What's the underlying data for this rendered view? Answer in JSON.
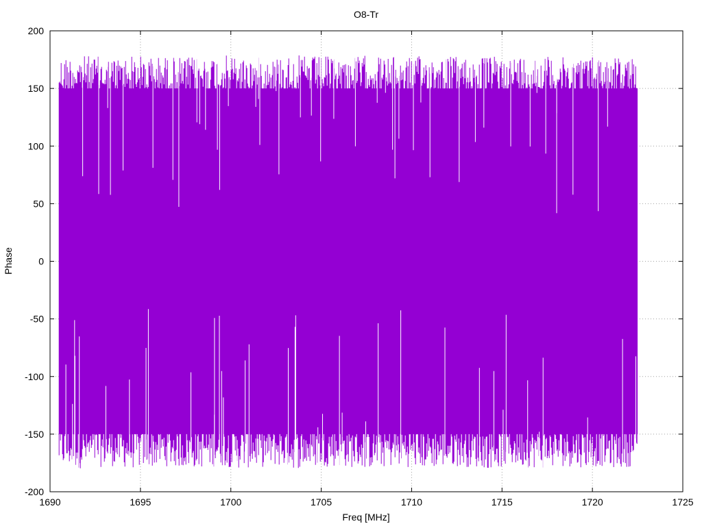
{
  "chart_data": {
    "type": "line",
    "title": "O8-Tr",
    "xlabel": "Freq [MHz]",
    "ylabel": "Phase",
    "xlim": [
      1690,
      1725
    ],
    "ylim": [
      -200,
      200
    ],
    "xticks": [
      "1690",
      "1695",
      "1700",
      "1705",
      "1710",
      "1715",
      "1720",
      "1725"
    ],
    "yticks": [
      "200",
      "150",
      "100",
      "50",
      "0",
      "-50",
      "-100",
      "-150",
      "-200"
    ],
    "grid": true,
    "legend": "none",
    "series": [
      {
        "color": "#9400d3",
        "x_range": [
          1690.5,
          1722.5
        ],
        "y_range": [
          -180,
          180
        ],
        "sample_envelope": {
          "x": [
            1690.5,
            1691.5,
            1692.5,
            1693.5,
            1694.5,
            1695.5,
            1696.5,
            1697.5,
            1698.5,
            1699.5,
            1700.5,
            1701.5,
            1702.5,
            1703.5,
            1704.5,
            1705.5,
            1706.5,
            1707.5,
            1708.5,
            1709.5,
            1710.5,
            1711.5,
            1712.5,
            1713.5,
            1714.5,
            1715.5,
            1716.5,
            1717.5,
            1718.5,
            1719.5,
            1720.5,
            1721.5,
            1722.4
          ],
          "y_max": [
            178,
            179,
            178,
            177,
            179,
            178,
            178,
            177,
            178,
            179,
            178,
            177,
            178,
            179,
            178,
            178,
            177,
            179,
            178,
            177,
            178,
            179,
            178,
            177,
            178,
            178,
            179,
            178,
            177,
            178,
            179,
            178,
            176
          ],
          "y_min": [
            -179,
            -180,
            -179,
            -178,
            -180,
            -179,
            -178,
            -180,
            -179,
            -178,
            -180,
            -179,
            -178,
            -180,
            -179,
            -178,
            -179,
            -180,
            -179,
            -178,
            -180,
            -179,
            -178,
            -179,
            -180,
            -178,
            -179,
            -180,
            -178,
            -179,
            -178,
            -180,
            -177
          ]
        }
      }
    ]
  }
}
